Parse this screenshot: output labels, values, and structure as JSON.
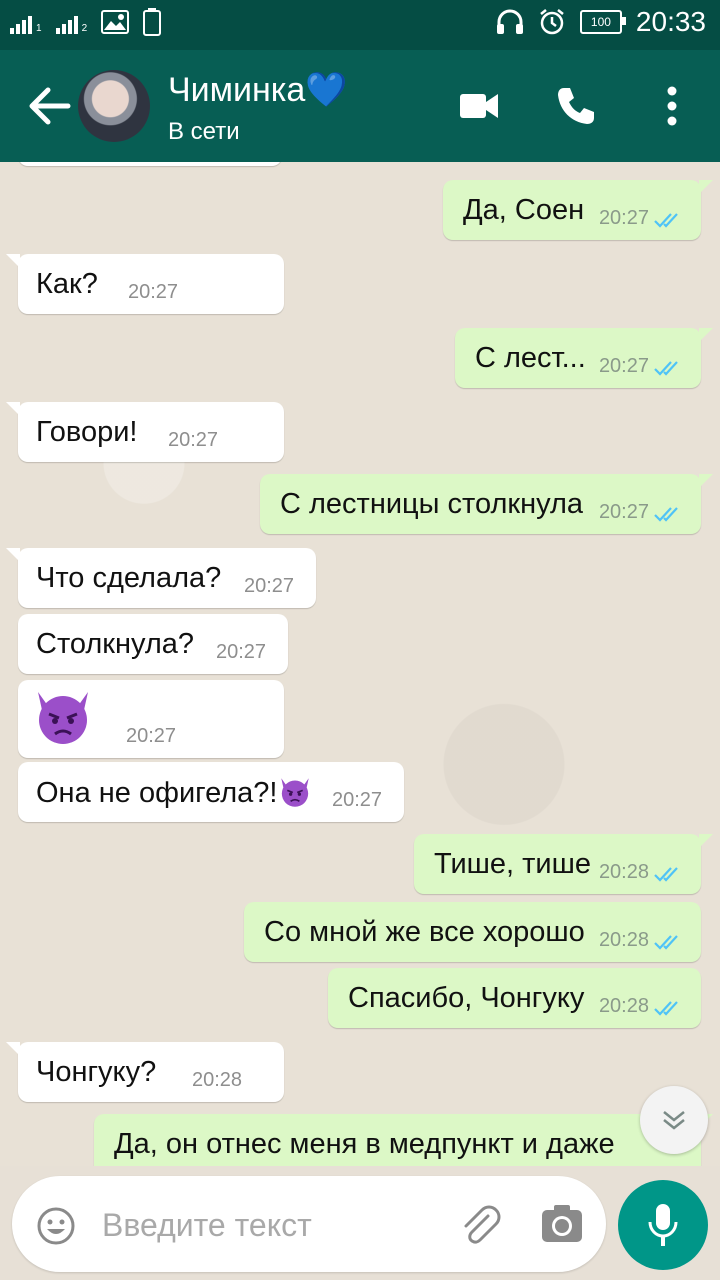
{
  "status_bar": {
    "sim1": "1",
    "sim2": "2",
    "battery": "100",
    "time": "20:33"
  },
  "header": {
    "contact_name": "Чиминка💙",
    "status": "В сети",
    "icons": [
      "back-arrow-icon",
      "video-call-icon",
      "phone-icon",
      "more-vert-icon"
    ]
  },
  "messages": [
    {
      "dir": "out",
      "text": "Да, Соен",
      "time": "20:27"
    },
    {
      "dir": "in",
      "text": "Как?",
      "time": "20:27"
    },
    {
      "dir": "out",
      "text": "С лест...",
      "time": "20:27"
    },
    {
      "dir": "in",
      "text": "Говори!",
      "time": "20:27"
    },
    {
      "dir": "out",
      "text": "С лестницы столкнула",
      "time": "20:27"
    },
    {
      "dir": "in",
      "text": "Что сделала?",
      "time": "20:27"
    },
    {
      "dir": "in",
      "text": "Столкнула?",
      "time": "20:27"
    },
    {
      "dir": "in",
      "text": "",
      "emoji": "angry-devil-emoji",
      "time": "20:27"
    },
    {
      "dir": "in",
      "text": "Она не офигела?!",
      "emoji": "angry-devil-emoji",
      "time": "20:27"
    },
    {
      "dir": "out",
      "text": "Тише, тише",
      "time": "20:28"
    },
    {
      "dir": "out",
      "text": "Со мной же все хорошо",
      "time": "20:28"
    },
    {
      "dir": "out",
      "text": "Спасибо, Чонгуку",
      "time": "20:28"
    },
    {
      "dir": "in",
      "text": "Чонгуку?",
      "time": "20:28"
    },
    {
      "dir": "out",
      "text": "Да, он отнес меня в медпункт и даже",
      "time": ""
    }
  ],
  "input": {
    "placeholder": "Введите текст",
    "icons": [
      "emoji-icon",
      "attach-icon",
      "camera-icon",
      "mic-icon"
    ]
  },
  "colors": {
    "header": "#075e54",
    "status_bar": "#054d44",
    "outgoing_bubble": "#dcf8c6",
    "incoming_bubble": "#ffffff",
    "read_ticks": "#4fc3f7",
    "mic_button": "#009688"
  }
}
